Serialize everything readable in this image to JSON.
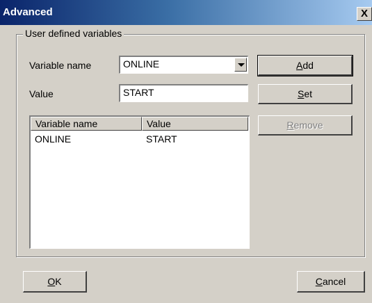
{
  "window": {
    "title": "Advanced",
    "close_glyph": "X"
  },
  "group": {
    "label": "User defined variables"
  },
  "form": {
    "variable_name_label": "Variable name",
    "variable_name_value": "ONLINE",
    "value_label": "Value",
    "value_value": "START"
  },
  "buttons": {
    "add": {
      "mnemonic": "A",
      "rest": "dd"
    },
    "set": {
      "mnemonic": "S",
      "rest": "et"
    },
    "remove": {
      "mnemonic": "R",
      "rest": "emove"
    },
    "ok": {
      "mnemonic": "O",
      "rest": "K"
    },
    "cancel": {
      "mnemonic": "C",
      "rest": "ancel"
    }
  },
  "list": {
    "columns": [
      "Variable name",
      "Value"
    ],
    "rows": [
      {
        "name": "ONLINE",
        "value": "START"
      }
    ]
  },
  "icons": {
    "dropdown": "chevron-down-icon",
    "close": "close-icon"
  }
}
